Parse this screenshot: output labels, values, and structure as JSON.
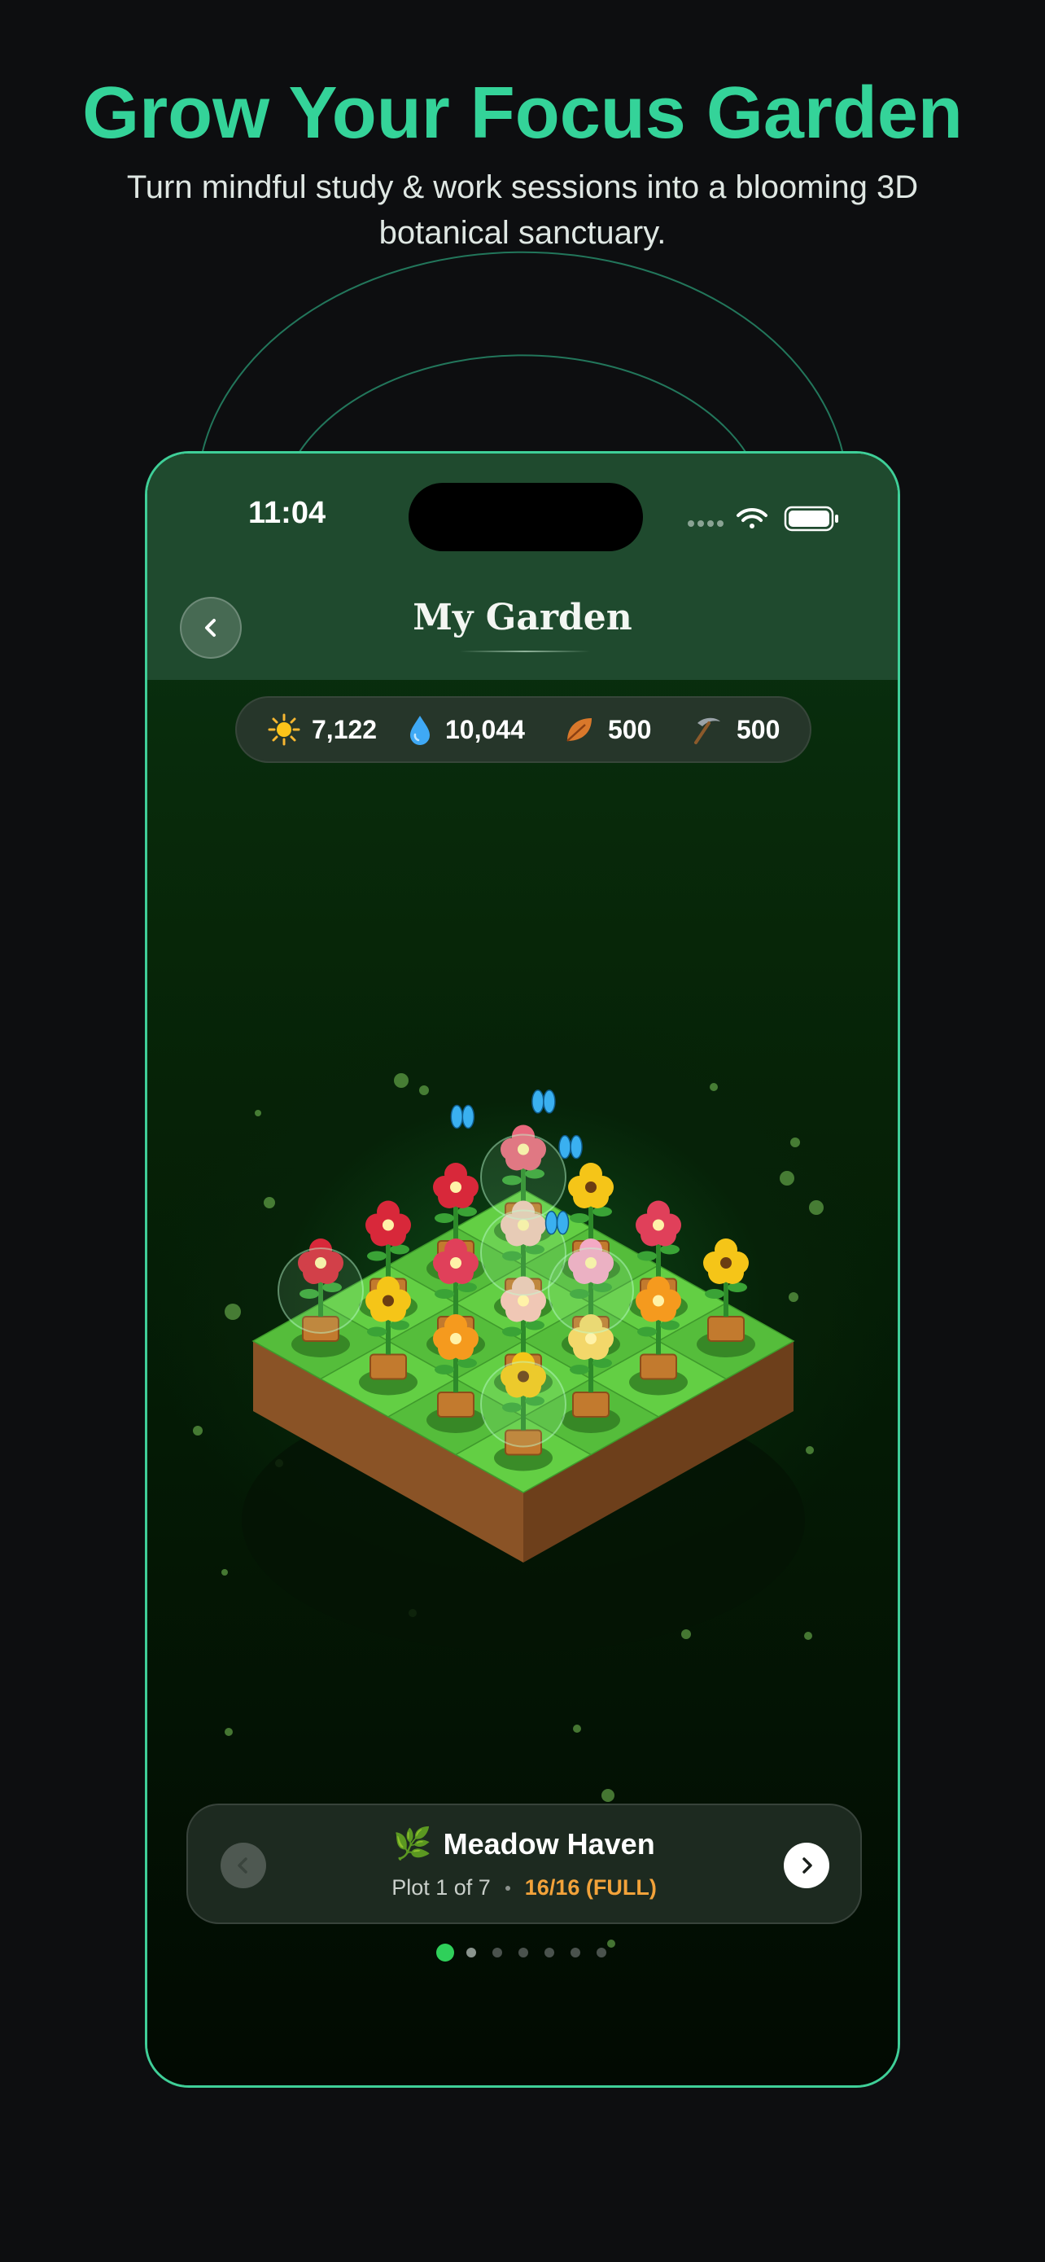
{
  "promo": {
    "headline": "Grow Your Focus Garden",
    "subline": "Turn mindful study & work sessions into a blooming 3D botanical sanctuary."
  },
  "status_bar": {
    "time": "11:04",
    "icons": [
      "signal-icon",
      "wifi-icon",
      "battery-icon"
    ]
  },
  "header": {
    "title": "My Garden",
    "back_icon": "chevron-left-icon"
  },
  "resources": [
    {
      "icon": "sun-icon",
      "value": "7,122"
    },
    {
      "icon": "water-drop-icon",
      "value": "10,044"
    },
    {
      "icon": "leaf-icon",
      "value": "500"
    },
    {
      "icon": "pickaxe-icon",
      "value": "500"
    }
  ],
  "garden": {
    "grid": "4x4",
    "plants": [
      "tulip",
      "rose",
      "rose",
      "rose",
      "sunflower",
      "zinnia",
      "hibiscus",
      "sunflower",
      "hibiscus",
      "cherry-blossom",
      "zinnia",
      "marigold",
      "sunflower",
      "marigold",
      "lotus",
      "sunflower"
    ]
  },
  "plot": {
    "emoji": "🌿",
    "name": "Meadow Haven",
    "index_label": "Plot 1 of 7",
    "status": "16/16 (FULL)",
    "prev_icon": "chevron-left-icon",
    "next_icon": "chevron-right-icon"
  },
  "pager": {
    "count": 7,
    "active": 0
  },
  "colors": {
    "accent": "#34d399",
    "status_full": "#f2a23a",
    "header_bg": "#1f4a2e",
    "grass": "#5cc63f",
    "soil": "#7a4a22"
  }
}
